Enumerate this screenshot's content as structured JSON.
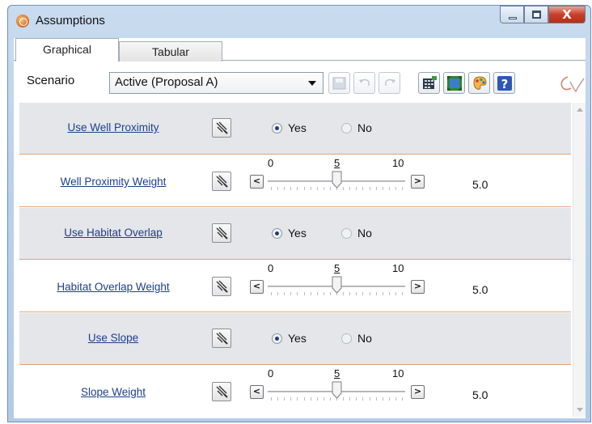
{
  "window": {
    "title": "Assumptions",
    "close_glyph": "X"
  },
  "tabs": [
    {
      "label": "Graphical",
      "active": true
    },
    {
      "label": "Tabular",
      "active": false
    }
  ],
  "toolbar": {
    "scenario_label": "Scenario",
    "scenario_value": "Active (Proposal A)",
    "icons": [
      "save-icon",
      "undo-icon",
      "redo-icon",
      "table-icon",
      "fit-icon",
      "palette-icon",
      "help-icon"
    ]
  },
  "rows": [
    {
      "type": "toggle",
      "label": "Use Well Proximity",
      "yes_label": "Yes",
      "no_label": "No",
      "value": "Yes"
    },
    {
      "type": "slider",
      "label": "Well Proximity Weight",
      "min_label": "0",
      "mid_label": "5",
      "max_label": "10",
      "value": 5,
      "value_text": "5.0"
    },
    {
      "type": "toggle",
      "label": "Use Habitat Overlap",
      "yes_label": "Yes",
      "no_label": "No",
      "value": "Yes"
    },
    {
      "type": "slider",
      "label": "Habitat Overlap Weight",
      "min_label": "0",
      "mid_label": "5",
      "max_label": "10",
      "value": 5,
      "value_text": "5.0"
    },
    {
      "type": "toggle",
      "label": "Use Slope",
      "yes_label": "Yes",
      "no_label": "No",
      "value": "Yes"
    },
    {
      "type": "slider",
      "label": "Slope Weight",
      "min_label": "0",
      "mid_label": "5",
      "max_label": "10",
      "value": 5,
      "value_text": "5.0"
    }
  ],
  "colors": {
    "link": "#1d3f8a",
    "row_shaded": "#e4e6e9",
    "row_divider": "#e2a27a"
  }
}
